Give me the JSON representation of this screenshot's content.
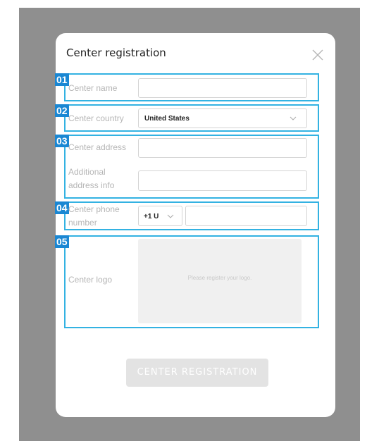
{
  "modal": {
    "title": "Center registration",
    "close_icon": "close-icon",
    "register_button": "CENTER REGISTRATION"
  },
  "sections": {
    "s1": {
      "badge": "01",
      "label": "Center name",
      "value": ""
    },
    "s2": {
      "badge": "02",
      "label": "Center country",
      "value": "United States"
    },
    "s3": {
      "badge": "03",
      "label_address": "Center address",
      "label_additional_1": "Additional",
      "label_additional_2": "address info",
      "address_value": "",
      "additional_value": ""
    },
    "s4": {
      "badge": "04",
      "label_1": "Center phone",
      "label_2": "number",
      "country_code": "+1 U",
      "phone_value": ""
    },
    "s5": {
      "badge": "05",
      "label": "Center logo",
      "placeholder": "Please register your logo."
    }
  },
  "colors": {
    "backdrop": "#8f8f8f",
    "highlight_border": "#33b2e2",
    "badge": "#1a87d3",
    "button_disabled": "#e3e3e3"
  }
}
